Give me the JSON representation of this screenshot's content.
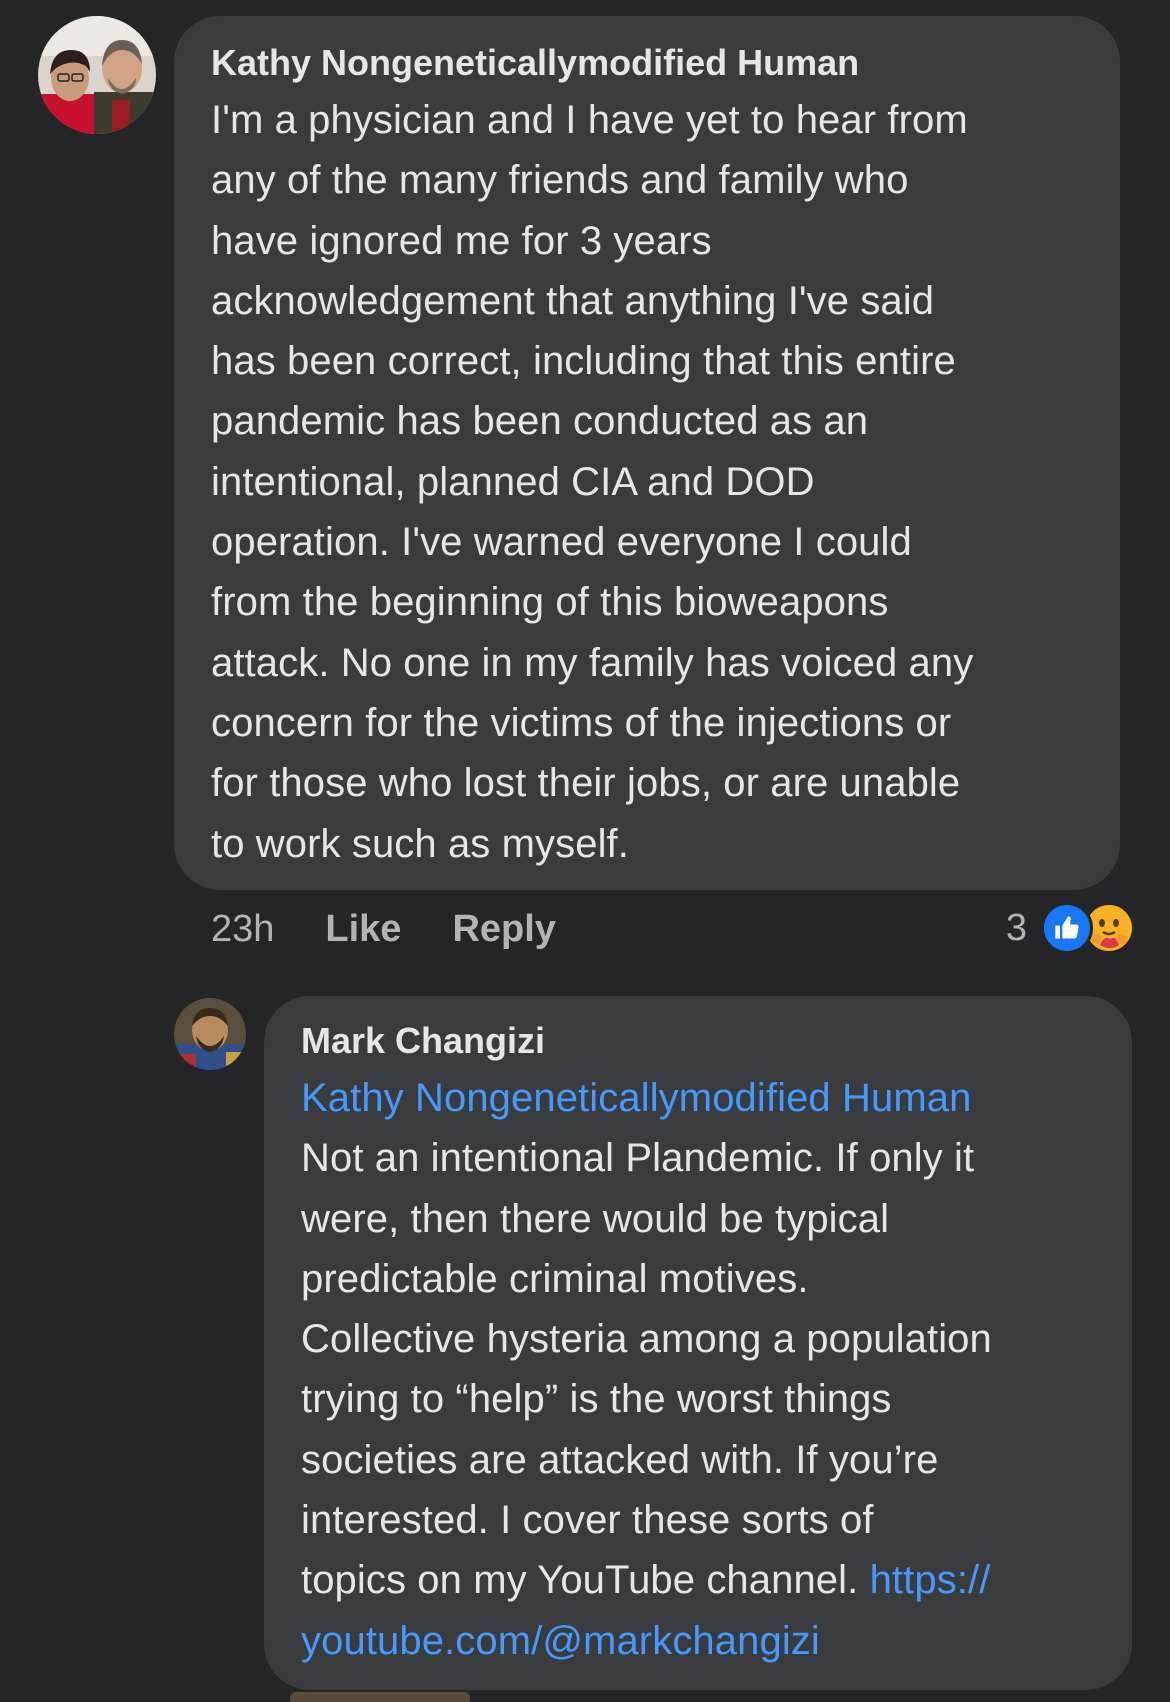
{
  "comment1": {
    "author": "Kathy Nongeneticallymodified Human",
    "body_lines": [
      "I'm a physician and I have yet to hear from",
      "any of the many friends and family who",
      "have ignored me for 3 years",
      "acknowledgement that anything I've said",
      "has been correct, including that this entire",
      "pandemic has been conducted as an",
      "intentional, planned CIA and DOD",
      "operation. I've warned everyone I could",
      "from the beginning of this bioweapons",
      "attack. No one in my family has voiced any",
      "concern for the victims of the injections or",
      "for those who lost their jobs, or are unable",
      "to work such as myself."
    ],
    "time": "23h",
    "like_label": "Like",
    "reply_label": "Reply",
    "reaction_count": "3",
    "reaction_icons": [
      "like-icon",
      "care-icon"
    ]
  },
  "comment2": {
    "author": "Mark Changizi",
    "mention": "Kathy Nongeneticallymodified Human",
    "body_lines": [
      "Not an intentional Plandemic. If only it",
      "were, then there would be typical",
      "predictable criminal motives.",
      "Collective hysteria among a population",
      "trying to “help” is the worst things",
      "societies are attacked with. If you’re",
      "interested. I cover these sorts of"
    ],
    "last_line_text": "topics on my YouTube channel. ",
    "link_part1": "https://",
    "link_part2": "youtube.com/@markchangizi"
  },
  "colors": {
    "background": "#242526",
    "bubble": "#3a3b3c",
    "text": "#e4e6eb",
    "muted": "#b0b3b8",
    "link": "#4599ff",
    "like_blue": "#1877f2",
    "care_yellow": "#f7b125"
  }
}
